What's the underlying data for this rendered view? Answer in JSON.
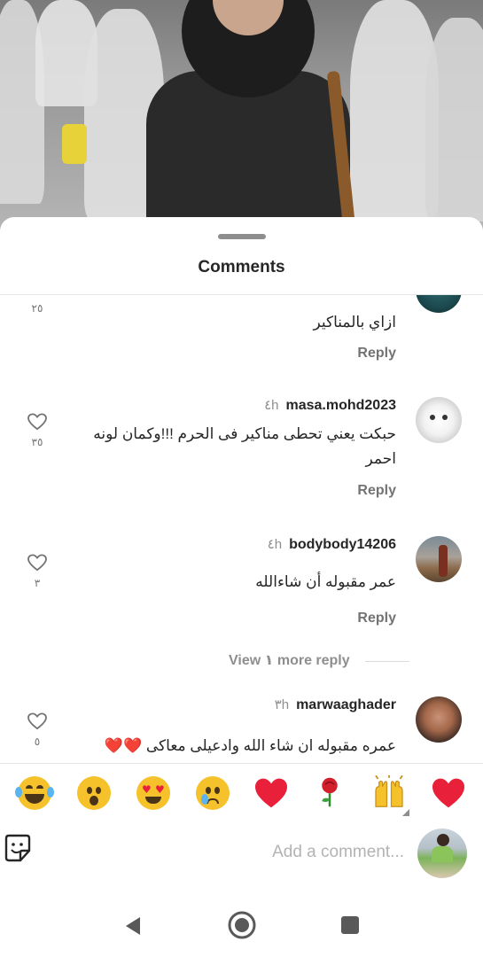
{
  "sheet": {
    "title": "Comments"
  },
  "comments": [
    {
      "username": "",
      "time": "",
      "text": "ازاي بالمناكير",
      "likes": "٢٥",
      "reply_label": "Reply"
    },
    {
      "username": "masa.mohd2023",
      "time": "٤h",
      "text": "حبكت يعني تحطى مناكير فى الحرم !!!وكمان لونه احمر",
      "likes": "٣٥",
      "reply_label": "Reply"
    },
    {
      "username": "bodybody14206",
      "time": "٤h",
      "text": "عمر مقبوله أن شاءالله",
      "likes": "٣",
      "reply_label": "Reply",
      "view_replies": "View ١ more reply"
    },
    {
      "username": "marwaaghader",
      "time": "٣h",
      "text": "عمره مقبوله ان شاء الله وادعيلى معاكى ❤️❤️",
      "likes": "٥"
    }
  ],
  "emoji_bar": [
    {
      "name": "face-with-tears-of-joy",
      "glyph": "😂"
    },
    {
      "name": "face-with-open-mouth",
      "glyph": "😮"
    },
    {
      "name": "smiling-face-with-heart-eyes",
      "glyph": "😍"
    },
    {
      "name": "crying-face",
      "glyph": "😢"
    },
    {
      "name": "red-heart",
      "glyph": "❤️"
    },
    {
      "name": "rose",
      "glyph": "🌹"
    },
    {
      "name": "raising-hands",
      "glyph": "🙌"
    },
    {
      "name": "red-heart",
      "glyph": "❤️"
    }
  ],
  "composer": {
    "placeholder": "Add a comment..."
  },
  "colors": {
    "heart_red": "#e8203a",
    "muted_text": "#8e8e8e",
    "primary_text": "#262626"
  }
}
